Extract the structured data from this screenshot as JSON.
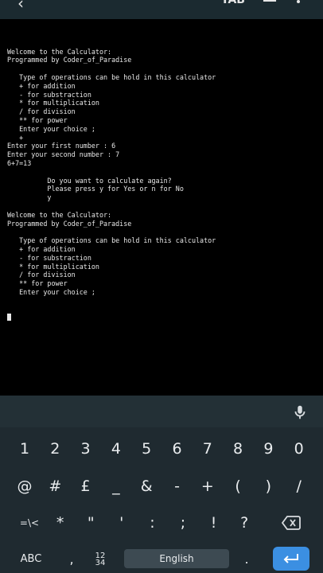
{
  "topbar": {
    "back_glyph": "‹",
    "tab_label": "TAB",
    "dash_glyph": "—"
  },
  "terminal": {
    "lines": [
      "Welcome to the Calculator:",
      "Programmed by Coder_of_Paradise",
      "",
      "   Type of operations can be hold in this calculator",
      "   + for addition",
      "   - for substraction",
      "   * for multiplication",
      "   / for division",
      "   ** for power",
      "   Enter your choice ;",
      "   +",
      "Enter your first number : 6",
      "Enter your second number : 7",
      "6+7=13",
      "",
      "          Do you want to calculate again?",
      "          Please press y for Yes or n for No",
      "          y",
      "",
      "Welcome to the Calculator:",
      "Programmed by Coder_of_Paradise",
      "",
      "   Type of operations can be hold in this calculator",
      "   + for addition",
      "   - for substraction",
      "   * for multiplication",
      "   / for division",
      "   ** for power",
      "   Enter your choice ;"
    ]
  },
  "keyboard": {
    "row1": [
      "1",
      "2",
      "3",
      "4",
      "5",
      "6",
      "7",
      "8",
      "9",
      "0"
    ],
    "row2": [
      "@",
      "#",
      "£",
      "_",
      "&",
      "-",
      "+",
      "(",
      ")",
      "/"
    ],
    "row3": [
      "=\\<",
      "*",
      "\"",
      "'",
      ":",
      ";",
      "!",
      "?"
    ],
    "abc_label": "ABC",
    "comma": ",",
    "numpad_label_top": "12",
    "numpad_label_bottom": "34",
    "space_label": "English",
    "period": ".",
    "enter_color": "#3b8fe2"
  }
}
